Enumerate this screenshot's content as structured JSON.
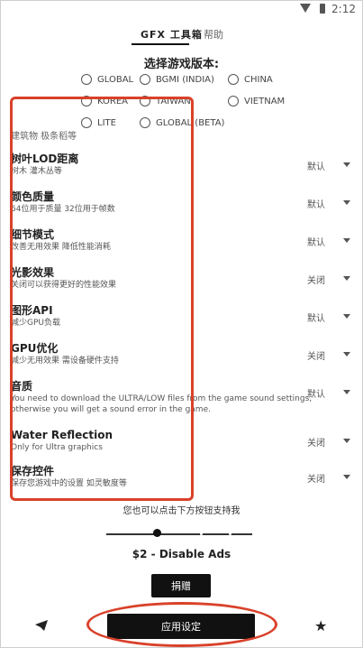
{
  "status_bar": {
    "time": "2:12"
  },
  "tabs": [
    {
      "label": "GFX 工具箱"
    },
    {
      "label": "帮助"
    }
  ],
  "heading": "选择游戏版本:",
  "versions": [
    {
      "label": "GLOBAL"
    },
    {
      "label": "BGMI (INDIA)"
    },
    {
      "label": "CHINA"
    },
    {
      "label": "KOREA"
    },
    {
      "label": "TAIWAN"
    },
    {
      "label": "VIETNAM"
    },
    {
      "label": "LITE"
    },
    {
      "label": "GLOBAL (BETA)"
    }
  ],
  "settings": {
    "scroll_top_text": "建筑物 极条稻等",
    "items": [
      {
        "title": "树叶LOD距离",
        "desc": "树木 灌木丛等",
        "value": "默认"
      },
      {
        "title": "颜色质量",
        "desc": "64位用于质量 32位用于帧数",
        "value": "默认"
      },
      {
        "title": "细节模式",
        "desc": "改善无用效果 降低性能消耗",
        "value": "默认"
      },
      {
        "title": "光影效果",
        "desc": "关闭可以获得更好的性能效果",
        "value": "关闭"
      },
      {
        "title": "图形API",
        "desc": "减少GPU负载",
        "value": "默认"
      },
      {
        "title": "GPU优化",
        "desc": "减少无用效果 需设备硬件支持",
        "value": "关闭"
      },
      {
        "title": "音质",
        "desc": "You need to download the ULTRA/LOW files from the game sound settings, otherwise you will get a sound error in the game.",
        "value": "默认"
      },
      {
        "title": "Water Reflection",
        "desc": "Only for Ultra graphics",
        "value": "关闭"
      },
      {
        "title": "保存控件",
        "desc": "保存您游戏中的设置 如灵敏度等",
        "value": "关闭"
      }
    ]
  },
  "support_text": "您也可以点击下方按钮支持我",
  "slider": {
    "level": 0.33
  },
  "price": "$2 - Disable Ads",
  "donate_label": "捐赠",
  "apply_label": "应用设定",
  "accent_color": "#d9412a"
}
